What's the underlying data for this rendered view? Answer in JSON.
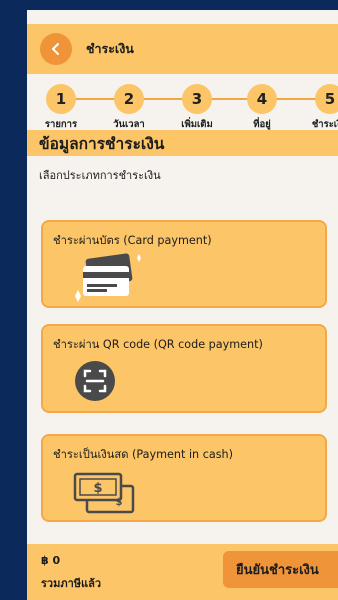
{
  "header": {
    "title": "ชำระเงิน",
    "back_icon": "chevron-left-icon"
  },
  "steps": [
    {
      "number": "1",
      "label": "รายการ"
    },
    {
      "number": "2",
      "label": "วันเวลา"
    },
    {
      "number": "3",
      "label": "เพิ่มเติม"
    },
    {
      "number": "4",
      "label": "ที่อยู่"
    },
    {
      "number": "5",
      "label": "ชำระเงิน"
    }
  ],
  "section": {
    "title": "ข้อมูลการชำระเงิน",
    "subtitle": "เลือกประเภทการชำระเงิน"
  },
  "payment_options": [
    {
      "label": "ชำระผ่านบัตร (Card payment)",
      "icon": "credit-card-icon"
    },
    {
      "label": "ชำระผ่าน QR code (QR code payment)",
      "icon": "qr-scan-icon"
    },
    {
      "label": "ชำระเป็นเงินสด (Payment in cash)",
      "icon": "cash-icon"
    }
  ],
  "footer": {
    "total": "฿ 0",
    "total_label": "รวมภาษีแล้ว",
    "confirm_label": "ยืนยันชำระเงิน"
  },
  "colors": {
    "background": "#0b2a5b",
    "accent": "#fcc567",
    "accent_dark": "#f0943a",
    "panel": "#f6f3ee"
  }
}
